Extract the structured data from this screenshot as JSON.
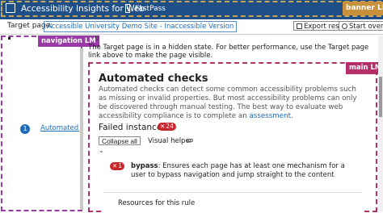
{
  "banner": {
    "title": "Accessibility Insights for Web",
    "fastpass_label": "FastPass",
    "landmark_tag": "banner LM"
  },
  "toolbar": {
    "target_label": "Target page:",
    "target_link": "Accessible University Demo Site - Inaccessible Version",
    "export_label": "Export result",
    "start_over_label": "Start over"
  },
  "nav": {
    "landmark_tag": "navigation LM",
    "item_number": "1",
    "item_label": "Automated checks"
  },
  "main": {
    "landmark_tag": "main LM",
    "notice": "The Target page is in a hidden state. For better performance, use the Target page link above to make the page visible.",
    "heading": "Automated checks",
    "description": "Automated checks can detect some common accessibility problems such as missing or invalid properties. But most accessibility problems can only be discovered through manual testing. The best way to evaluate web accessibility compliance is to complete an",
    "assessment_link": "assessment",
    "failed_heading": "Failed instances",
    "failed_count": "24",
    "collapse_label": "Collapse all",
    "visual_helper_label": "Visual helper",
    "rule_count": "1",
    "rule_name": "bypass",
    "rule_text": ": Ensures each page has at least one mechanism for a user to bypass navigation and jump straight to the content",
    "resources_title": "Resources for this rule"
  },
  "colors": {
    "banner_bg": "#1e4f86",
    "banner_landmark": "#c8903a",
    "nav_landmark": "#9a3aa6",
    "main_landmark": "#b5306b",
    "failure_red": "#c8262a",
    "link_blue": "#1e6bb8"
  }
}
